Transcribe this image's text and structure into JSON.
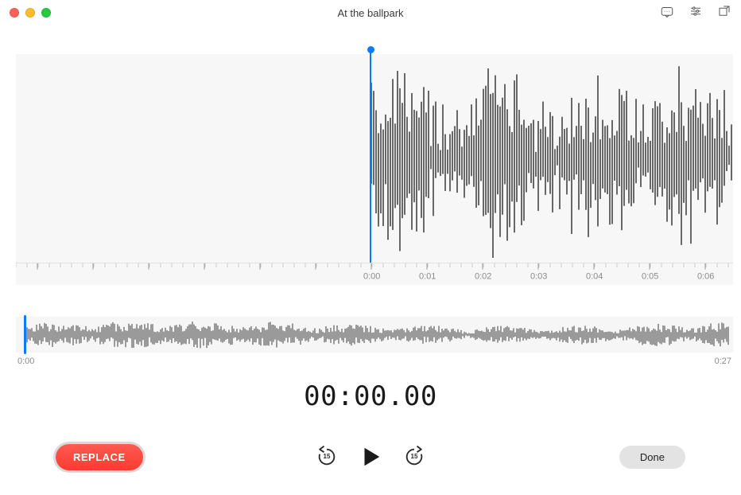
{
  "window": {
    "title": "At the ballpark"
  },
  "toolbar": {
    "transcript_icon": "transcript",
    "settings_icon": "settings",
    "trim_icon": "trim"
  },
  "detail": {
    "ruler_labels": [
      "0:00",
      "0:01",
      "0:02",
      "0:03",
      "0:04",
      "0:05",
      "0:06"
    ],
    "playhead_position_sec": 0.0
  },
  "overview": {
    "start_label": "0:00",
    "end_label": "0:27",
    "duration_sec": 27
  },
  "timer": {
    "display": "00:00.00"
  },
  "controls": {
    "replace_label": "REPLACE",
    "skip_back_seconds": "15",
    "skip_fwd_seconds": "15",
    "done_label": "Done"
  }
}
